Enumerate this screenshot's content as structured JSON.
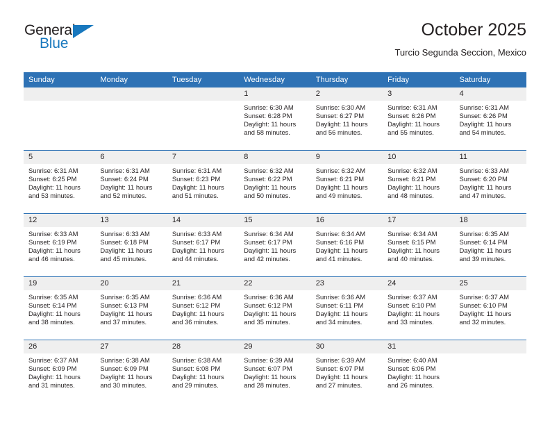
{
  "brand": {
    "name_top": "General",
    "name_bottom": "Blue",
    "accent_color": "#1878be"
  },
  "header": {
    "title": "October 2025",
    "subtitle": "Turcio Segunda Seccion, Mexico"
  },
  "theme": {
    "header_blue": "#2e72b5",
    "daynum_gray": "#efefef",
    "text": "#231f20"
  },
  "calendar": {
    "weekdays": [
      "Sunday",
      "Monday",
      "Tuesday",
      "Wednesday",
      "Thursday",
      "Friday",
      "Saturday"
    ],
    "weeks": [
      [
        {
          "day": "",
          "sunrise": "",
          "sunset": "",
          "daylight_1": "",
          "daylight_2": ""
        },
        {
          "day": "",
          "sunrise": "",
          "sunset": "",
          "daylight_1": "",
          "daylight_2": ""
        },
        {
          "day": "",
          "sunrise": "",
          "sunset": "",
          "daylight_1": "",
          "daylight_2": ""
        },
        {
          "day": "1",
          "sunrise": "Sunrise: 6:30 AM",
          "sunset": "Sunset: 6:28 PM",
          "daylight_1": "Daylight: 11 hours",
          "daylight_2": "and 58 minutes."
        },
        {
          "day": "2",
          "sunrise": "Sunrise: 6:30 AM",
          "sunset": "Sunset: 6:27 PM",
          "daylight_1": "Daylight: 11 hours",
          "daylight_2": "and 56 minutes."
        },
        {
          "day": "3",
          "sunrise": "Sunrise: 6:31 AM",
          "sunset": "Sunset: 6:26 PM",
          "daylight_1": "Daylight: 11 hours",
          "daylight_2": "and 55 minutes."
        },
        {
          "day": "4",
          "sunrise": "Sunrise: 6:31 AM",
          "sunset": "Sunset: 6:26 PM",
          "daylight_1": "Daylight: 11 hours",
          "daylight_2": "and 54 minutes."
        }
      ],
      [
        {
          "day": "5",
          "sunrise": "Sunrise: 6:31 AM",
          "sunset": "Sunset: 6:25 PM",
          "daylight_1": "Daylight: 11 hours",
          "daylight_2": "and 53 minutes."
        },
        {
          "day": "6",
          "sunrise": "Sunrise: 6:31 AM",
          "sunset": "Sunset: 6:24 PM",
          "daylight_1": "Daylight: 11 hours",
          "daylight_2": "and 52 minutes."
        },
        {
          "day": "7",
          "sunrise": "Sunrise: 6:31 AM",
          "sunset": "Sunset: 6:23 PM",
          "daylight_1": "Daylight: 11 hours",
          "daylight_2": "and 51 minutes."
        },
        {
          "day": "8",
          "sunrise": "Sunrise: 6:32 AM",
          "sunset": "Sunset: 6:22 PM",
          "daylight_1": "Daylight: 11 hours",
          "daylight_2": "and 50 minutes."
        },
        {
          "day": "9",
          "sunrise": "Sunrise: 6:32 AM",
          "sunset": "Sunset: 6:21 PM",
          "daylight_1": "Daylight: 11 hours",
          "daylight_2": "and 49 minutes."
        },
        {
          "day": "10",
          "sunrise": "Sunrise: 6:32 AM",
          "sunset": "Sunset: 6:21 PM",
          "daylight_1": "Daylight: 11 hours",
          "daylight_2": "and 48 minutes."
        },
        {
          "day": "11",
          "sunrise": "Sunrise: 6:33 AM",
          "sunset": "Sunset: 6:20 PM",
          "daylight_1": "Daylight: 11 hours",
          "daylight_2": "and 47 minutes."
        }
      ],
      [
        {
          "day": "12",
          "sunrise": "Sunrise: 6:33 AM",
          "sunset": "Sunset: 6:19 PM",
          "daylight_1": "Daylight: 11 hours",
          "daylight_2": "and 46 minutes."
        },
        {
          "day": "13",
          "sunrise": "Sunrise: 6:33 AM",
          "sunset": "Sunset: 6:18 PM",
          "daylight_1": "Daylight: 11 hours",
          "daylight_2": "and 45 minutes."
        },
        {
          "day": "14",
          "sunrise": "Sunrise: 6:33 AM",
          "sunset": "Sunset: 6:17 PM",
          "daylight_1": "Daylight: 11 hours",
          "daylight_2": "and 44 minutes."
        },
        {
          "day": "15",
          "sunrise": "Sunrise: 6:34 AM",
          "sunset": "Sunset: 6:17 PM",
          "daylight_1": "Daylight: 11 hours",
          "daylight_2": "and 42 minutes."
        },
        {
          "day": "16",
          "sunrise": "Sunrise: 6:34 AM",
          "sunset": "Sunset: 6:16 PM",
          "daylight_1": "Daylight: 11 hours",
          "daylight_2": "and 41 minutes."
        },
        {
          "day": "17",
          "sunrise": "Sunrise: 6:34 AM",
          "sunset": "Sunset: 6:15 PM",
          "daylight_1": "Daylight: 11 hours",
          "daylight_2": "and 40 minutes."
        },
        {
          "day": "18",
          "sunrise": "Sunrise: 6:35 AM",
          "sunset": "Sunset: 6:14 PM",
          "daylight_1": "Daylight: 11 hours",
          "daylight_2": "and 39 minutes."
        }
      ],
      [
        {
          "day": "19",
          "sunrise": "Sunrise: 6:35 AM",
          "sunset": "Sunset: 6:14 PM",
          "daylight_1": "Daylight: 11 hours",
          "daylight_2": "and 38 minutes."
        },
        {
          "day": "20",
          "sunrise": "Sunrise: 6:35 AM",
          "sunset": "Sunset: 6:13 PM",
          "daylight_1": "Daylight: 11 hours",
          "daylight_2": "and 37 minutes."
        },
        {
          "day": "21",
          "sunrise": "Sunrise: 6:36 AM",
          "sunset": "Sunset: 6:12 PM",
          "daylight_1": "Daylight: 11 hours",
          "daylight_2": "and 36 minutes."
        },
        {
          "day": "22",
          "sunrise": "Sunrise: 6:36 AM",
          "sunset": "Sunset: 6:12 PM",
          "daylight_1": "Daylight: 11 hours",
          "daylight_2": "and 35 minutes."
        },
        {
          "day": "23",
          "sunrise": "Sunrise: 6:36 AM",
          "sunset": "Sunset: 6:11 PM",
          "daylight_1": "Daylight: 11 hours",
          "daylight_2": "and 34 minutes."
        },
        {
          "day": "24",
          "sunrise": "Sunrise: 6:37 AM",
          "sunset": "Sunset: 6:10 PM",
          "daylight_1": "Daylight: 11 hours",
          "daylight_2": "and 33 minutes."
        },
        {
          "day": "25",
          "sunrise": "Sunrise: 6:37 AM",
          "sunset": "Sunset: 6:10 PM",
          "daylight_1": "Daylight: 11 hours",
          "daylight_2": "and 32 minutes."
        }
      ],
      [
        {
          "day": "26",
          "sunrise": "Sunrise: 6:37 AM",
          "sunset": "Sunset: 6:09 PM",
          "daylight_1": "Daylight: 11 hours",
          "daylight_2": "and 31 minutes."
        },
        {
          "day": "27",
          "sunrise": "Sunrise: 6:38 AM",
          "sunset": "Sunset: 6:09 PM",
          "daylight_1": "Daylight: 11 hours",
          "daylight_2": "and 30 minutes."
        },
        {
          "day": "28",
          "sunrise": "Sunrise: 6:38 AM",
          "sunset": "Sunset: 6:08 PM",
          "daylight_1": "Daylight: 11 hours",
          "daylight_2": "and 29 minutes."
        },
        {
          "day": "29",
          "sunrise": "Sunrise: 6:39 AM",
          "sunset": "Sunset: 6:07 PM",
          "daylight_1": "Daylight: 11 hours",
          "daylight_2": "and 28 minutes."
        },
        {
          "day": "30",
          "sunrise": "Sunrise: 6:39 AM",
          "sunset": "Sunset: 6:07 PM",
          "daylight_1": "Daylight: 11 hours",
          "daylight_2": "and 27 minutes."
        },
        {
          "day": "31",
          "sunrise": "Sunrise: 6:40 AM",
          "sunset": "Sunset: 6:06 PM",
          "daylight_1": "Daylight: 11 hours",
          "daylight_2": "and 26 minutes."
        },
        {
          "day": "",
          "sunrise": "",
          "sunset": "",
          "daylight_1": "",
          "daylight_2": ""
        }
      ]
    ]
  }
}
